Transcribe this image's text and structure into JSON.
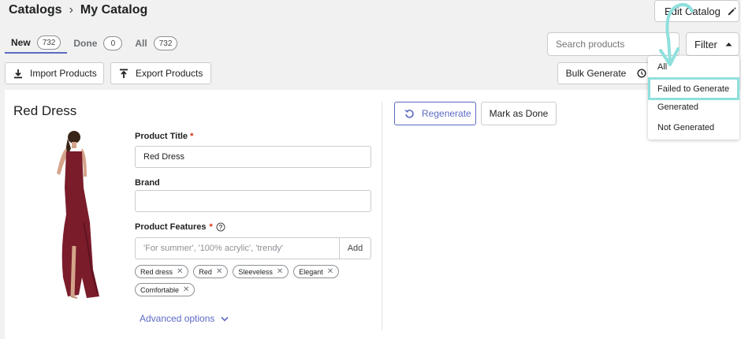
{
  "header": {
    "breadcrumb_root": "Catalogs",
    "breadcrumb_sep": "›",
    "breadcrumb_current": "My Catalog",
    "edit_button": "Edit Catalog"
  },
  "tabs": [
    {
      "label": "New",
      "count": "732"
    },
    {
      "label": "Done",
      "count": "0"
    },
    {
      "label": "All",
      "count": "732"
    }
  ],
  "search": {
    "placeholder": "Search products"
  },
  "filter": {
    "label": "Filter"
  },
  "toolbar": {
    "import_label": "Import Products",
    "export_label": "Export Products",
    "bulk_label": "Bulk Generate"
  },
  "product": {
    "name": "Red Dress",
    "title_label": "Product Title",
    "title_value": "Red Dress",
    "brand_label": "Brand",
    "brand_value": "",
    "features_label": "Product Features",
    "features_placeholder": "'For summer', '100% acrylic', 'trendy'",
    "add_label": "Add",
    "tags": [
      "Red dress",
      "Red",
      "Sleeveless",
      "Elegant",
      "Comfortable"
    ],
    "advanced_label": "Advanced options",
    "regenerate_label": "Regenerate",
    "mark_done_label": "Mark as Done"
  },
  "filter_menu": {
    "options": [
      "All",
      "Failed to Generate",
      "Generated",
      "Not Generated"
    ],
    "highlighted": "Failed to Generate"
  },
  "colors": {
    "accent": "#5c6ac4",
    "highlight": "#8fe0dd",
    "dress": "#7a1c2a",
    "required": "#d72c0d"
  }
}
